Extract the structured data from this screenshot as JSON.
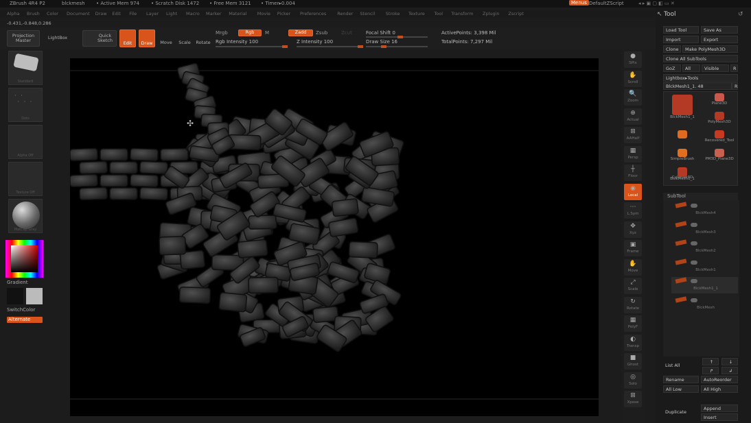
{
  "titlebar": {
    "app": "ZBrush 4R4 P2",
    "doc": "blckmesh",
    "active_mem": "• Active Mem 974",
    "scratch": "• Scratch Disk 1472",
    "free_mem": "• Free Mem 3121",
    "timer": "• Timer▸0.004",
    "menus_btn": "Menus",
    "script": "DefaultZScript"
  },
  "menubar": [
    "Alpha",
    "Brush",
    "Color",
    "Document",
    "Draw",
    "Edit",
    "File",
    "Layer",
    "Light",
    "Macro",
    "Marker",
    "Material",
    "Movie",
    "Picker",
    "Preferences",
    "Render",
    "Stencil",
    "Stroke",
    "Texture",
    "Tool",
    "Transform",
    "Zplugin",
    "Zscript"
  ],
  "coords": "-0.431,-0.848,0.286",
  "toolbar": {
    "projection_master": "Projection Master",
    "lightbox": "LightBox",
    "quick_sketch": "Quick Sketch",
    "edit": "Edit",
    "draw": "Draw",
    "move": "Move",
    "scale": "Scale",
    "rotate": "Rotate",
    "mrgb": "Mrgb",
    "rgb": "Rgb",
    "m": "M",
    "rgb_intensity": "Rgb Intensity 100",
    "zadd": "Zadd",
    "zsub": "Zsub",
    "zcut": "Zcut",
    "z_intensity": "Z Intensity 100",
    "focal_shift": "Focal Shift 0",
    "draw_size": "Draw Size 16",
    "active_points": "ActivePoints: 3,398 Mil",
    "total_points": "TotalPoints: 7,297 Mil"
  },
  "leftshelf": {
    "brush_label": "Standard",
    "stroke_label": "Dots",
    "alpha_label": "Alpha Off",
    "texture_label": "Texture Off",
    "material_label": "MatCap Gray",
    "gradient": "Gradient",
    "switchcolor": "SwitchColor",
    "alternate": "Alternate"
  },
  "rightshelf": [
    {
      "label": "SPix",
      "icon": "●"
    },
    {
      "label": "Scroll",
      "icon": "✋"
    },
    {
      "label": "Zoom",
      "icon": "🔍"
    },
    {
      "label": "Actual",
      "icon": "⊕"
    },
    {
      "label": "AAHalf",
      "icon": "⊞"
    },
    {
      "label": "Persp",
      "icon": "▦"
    },
    {
      "label": "Floor",
      "icon": "┼"
    },
    {
      "label": "Local",
      "icon": "◉"
    },
    {
      "label": "L.Sym",
      "icon": "⋯"
    },
    {
      "label": "Xyz",
      "icon": "✥"
    },
    {
      "label": "Frame",
      "icon": "▣"
    },
    {
      "label": "Move",
      "icon": "✋"
    },
    {
      "label": "Scale",
      "icon": "⤢"
    },
    {
      "label": "Rotate",
      "icon": "↻"
    },
    {
      "label": "PolyF",
      "icon": "▦"
    },
    {
      "label": "Transp",
      "icon": "◐"
    },
    {
      "label": "Ghost",
      "icon": "■"
    },
    {
      "label": "Solo",
      "icon": "◎"
    },
    {
      "label": "Xpose",
      "icon": "⊞"
    }
  ],
  "toolpanel": {
    "title": "Tool",
    "load_tool": "Load Tool",
    "save_as": "Save As",
    "import": "Import",
    "export": "Export",
    "clone": "Clone",
    "make_polymesh": "Make PolyMesh3D",
    "clone_all": "Clone All SubTools",
    "goz": "GoZ",
    "all": "All",
    "visible": "Visible",
    "r": "R",
    "lightbox_tools": "Lightbox▸Tools",
    "current_tool": "BlckMesh1_1. 48",
    "tools": [
      "BlckMesh1_1",
      "Plane3D",
      "",
      "PolyMesh3D",
      "SimpleBrush",
      "Recovered_Tool",
      "Cylinder3D",
      "PM3D_Plane3D",
      "BlckMesh1_1"
    ],
    "subtool_header": "SubTool",
    "subtools": [
      "BlckMesh4",
      "BlckMesh3",
      "BlckMesh2",
      "BlckMesh1",
      "BlckMesh1_1",
      "BlckMesh"
    ],
    "list_all": "List All",
    "rename": "Rename",
    "autoreorder": "AutoReorder",
    "all_low": "All Low",
    "all_high": "All High",
    "duplicate": "Duplicate",
    "append": "Append",
    "insert": "Insert"
  }
}
